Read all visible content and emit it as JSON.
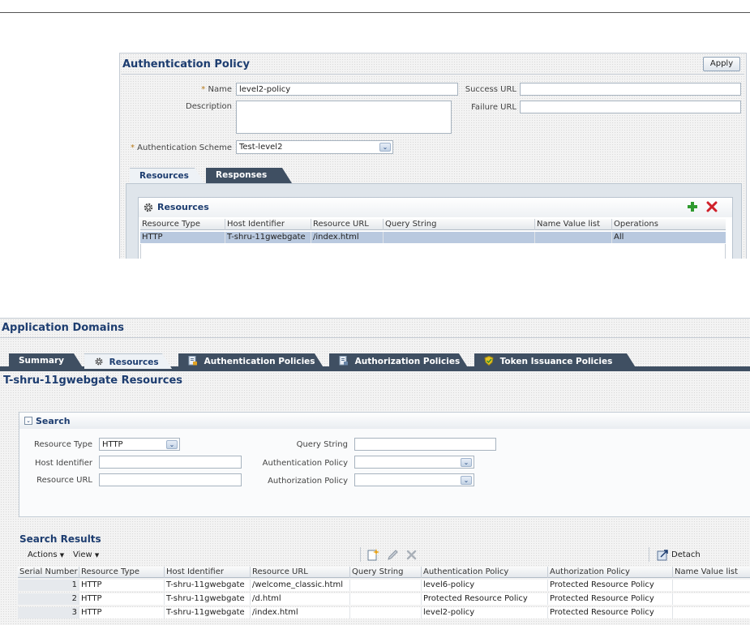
{
  "auth_policy": {
    "title": "Authentication Policy",
    "apply_label": "Apply",
    "name_label": "Name",
    "name_value": "level2-policy",
    "description_label": "Description",
    "description_value": "",
    "success_url_label": "Success URL",
    "success_url_value": "",
    "failure_url_label": "Failure URL",
    "failure_url_value": "",
    "scheme_label": "Authentication Scheme",
    "scheme_value": "Test-level2",
    "tabs": [
      {
        "label": "Resources",
        "active": true
      },
      {
        "label": "Responses",
        "active": false
      }
    ],
    "resources_title": "Resources",
    "columns": [
      "Resource Type",
      "Host Identifier",
      "Resource URL",
      "Query String",
      "Name Value list",
      "Operations"
    ],
    "rows": [
      [
        "HTTP",
        "T-shru-11gwebgate",
        "/index.html",
        "",
        "",
        "All"
      ]
    ]
  },
  "app_domains": {
    "title": "Application Domains",
    "tabs": [
      {
        "label": "Summary",
        "icon": "",
        "active": false
      },
      {
        "label": "Resources",
        "icon": "gear-icon",
        "active": true
      },
      {
        "label": "Authentication Policies",
        "icon": "policy-doc-icon",
        "active": false
      },
      {
        "label": "Authorization Policies",
        "icon": "policy-doc-icon",
        "active": false
      },
      {
        "label": "Token Issuance Policies",
        "icon": "shield-icon",
        "active": false
      }
    ],
    "section_title": "T-shru-11gwebgate Resources",
    "search": {
      "title": "Search",
      "resource_type_label": "Resource Type",
      "resource_type_value": "HTTP",
      "host_identifier_label": "Host Identifier",
      "host_identifier_value": "",
      "resource_url_label": "Resource URL",
      "resource_url_value": "",
      "query_string_label": "Query String",
      "query_string_value": "",
      "authn_policy_label": "Authentication Policy",
      "authn_policy_value": "",
      "authz_policy_label": "Authorization Policy",
      "authz_policy_value": ""
    },
    "results": {
      "title": "Search Results",
      "actions_label": "Actions",
      "view_label": "View",
      "detach_label": "Detach",
      "columns": [
        "Serial Number",
        "Resource Type",
        "Host Identifier",
        "Resource URL",
        "Query String",
        "Authentication Policy",
        "Authorization Policy",
        "Name Value list"
      ],
      "rows": [
        [
          "1",
          "HTTP",
          "T-shru-11gwebgate",
          "/welcome_classic.html",
          "",
          "level6-policy",
          "Protected Resource Policy",
          ""
        ],
        [
          "2",
          "HTTP",
          "T-shru-11gwebgate",
          "/d.html",
          "",
          "Protected Resource Policy",
          "Protected Resource Policy",
          ""
        ],
        [
          "3",
          "HTTP",
          "T-shru-11gwebgate",
          "/index.html",
          "",
          "level2-policy",
          "Protected Resource Policy",
          ""
        ]
      ]
    }
  },
  "colors": {
    "title_blue": "#1d3d70",
    "selected_row": "#b9c9df",
    "tab_dark": "#3f4f62",
    "add_green": "#2f9a2f",
    "delete_red": "#d0202a"
  }
}
